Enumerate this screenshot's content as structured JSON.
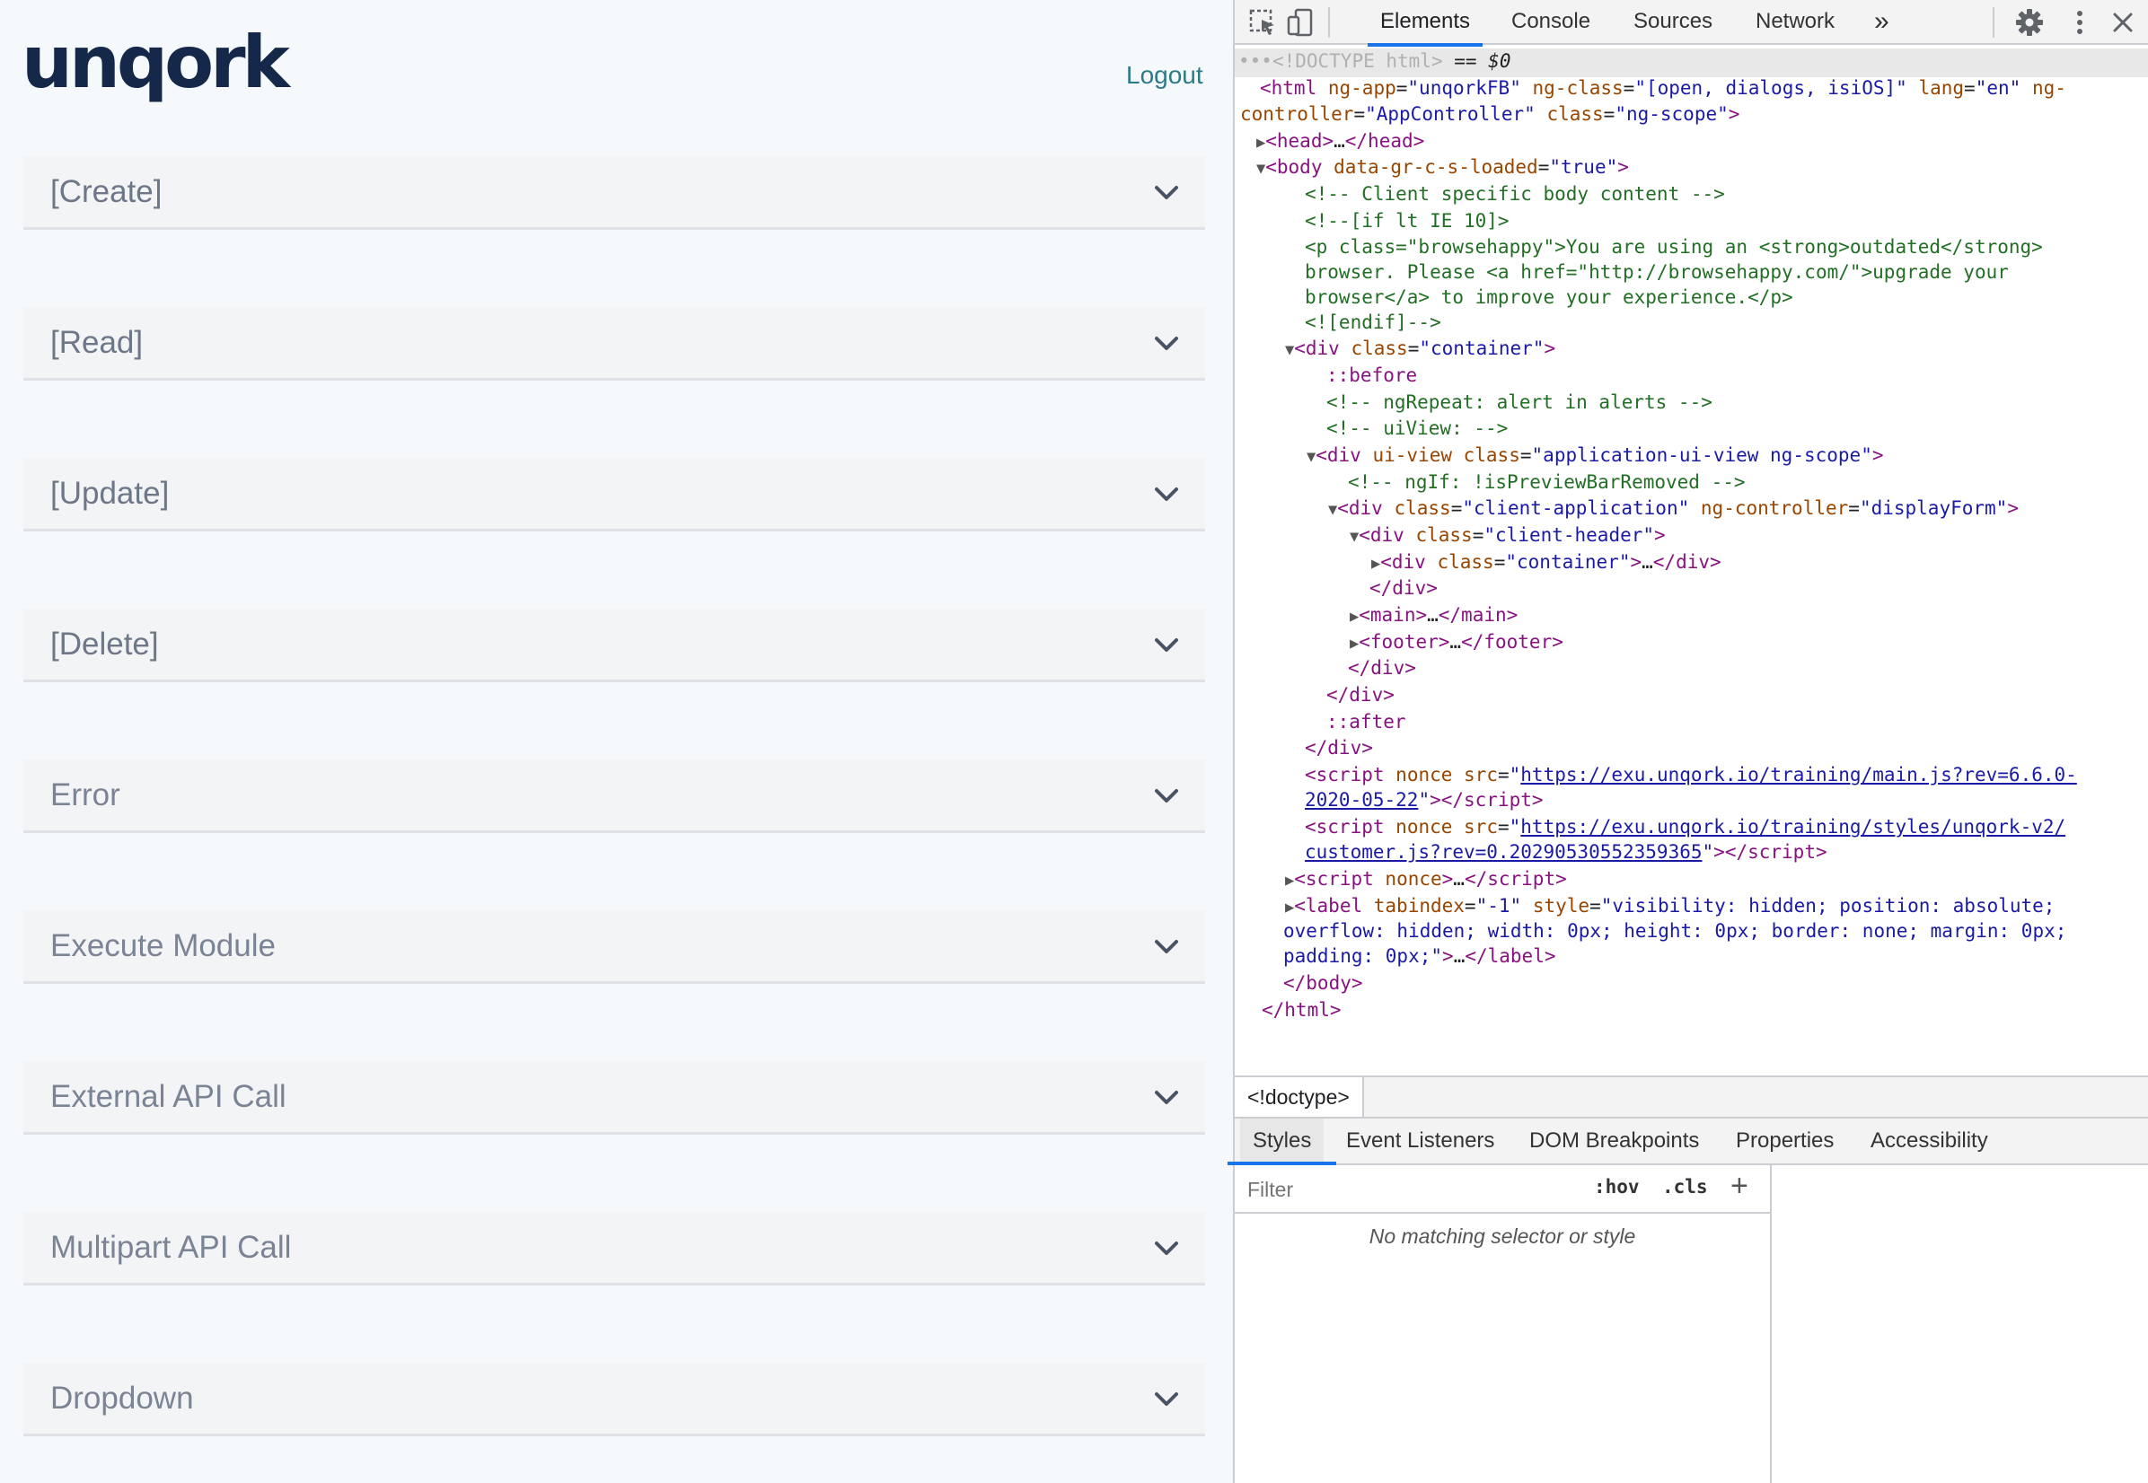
{
  "app": {
    "logo": "unqork",
    "logout_label": "Logout",
    "panels": [
      {
        "label": "[Create]"
      },
      {
        "label": "[Read]"
      },
      {
        "label": "[Update]"
      },
      {
        "label": "[Delete]"
      },
      {
        "label": "Error"
      },
      {
        "label": "Execute Module"
      },
      {
        "label": "External API Call"
      },
      {
        "label": "Multipart API Call"
      },
      {
        "label": "Dropdown"
      }
    ]
  },
  "devtools": {
    "tabs": {
      "elements": "Elements",
      "console": "Console",
      "sources": "Sources",
      "network": "Network",
      "more": "»"
    },
    "dom": {
      "l0_gray": "<!DOCTYPE html>",
      "l0_eq": " == ",
      "l0_var": "$0",
      "html_ngapp": "unqorkFB",
      "html_ngclass": "[open, dialogs, isiOS]",
      "html_lang": "en",
      "html_ctrl": "AppController",
      "html_class": "ng-scope",
      "body_attr_val": "true",
      "c1": "<!-- Client specific body content -->",
      "c2": "<!--[if lt IE 10]>",
      "c3a": "<p class=\"browsehappy\">You are using an <strong>outdated</strong>",
      "c3b": "browser. Please <a href=\"http://browsehappy.com/\">upgrade your",
      "c3c": "browser</a> to improve your experience.</p>",
      "c4": "<![endif]-->",
      "div_container": "container",
      "before": "::before",
      "c5": "<!-- ngRepeat: alert in alerts -->",
      "c6": "<!-- uiView: -->",
      "uiview_class": "application-ui-view ng-scope",
      "c7": "<!-- ngIf: !isPreviewBarRemoved -->",
      "client_app": "client-application",
      "display_form": "displayForm",
      "client_header": "client-header",
      "inner_container": "container",
      "after": "::after",
      "script1_a": "https://exu.unqork.io/training/main.js?rev=6.6.0-",
      "script1_b": "2020-05-22",
      "script2_a": "https://exu.unqork.io/training/styles/unqork-v2/",
      "script2_b": "customer.js?rev=0.20290530552359365",
      "label_tabindex": "-1",
      "label_style_a": "visibility: hidden; position: absolute;",
      "label_style_b": "overflow: hidden; width: 0px; height: 0px; border: none; margin: 0px;",
      "label_style_c": "padding: 0px;"
    },
    "breadcrumb": "<!doctype>",
    "subtabs": {
      "styles": "Styles",
      "listeners": "Event Listeners",
      "dom_bp": "DOM Breakpoints",
      "props": "Properties",
      "a11y": "Accessibility"
    },
    "filter_placeholder": "Filter",
    "hov": ":hov",
    "cls": ".cls",
    "plus": "+",
    "no_match": "No matching selector or style"
  },
  "colors": {
    "accent": "#1a73e8",
    "logo": "#16284a",
    "logout": "#2d7a8a"
  },
  "icons": [
    "inspect-icon",
    "device-toggle-icon",
    "gear-icon",
    "kebab-menu-icon",
    "close-icon",
    "chevron-down-icon"
  ]
}
